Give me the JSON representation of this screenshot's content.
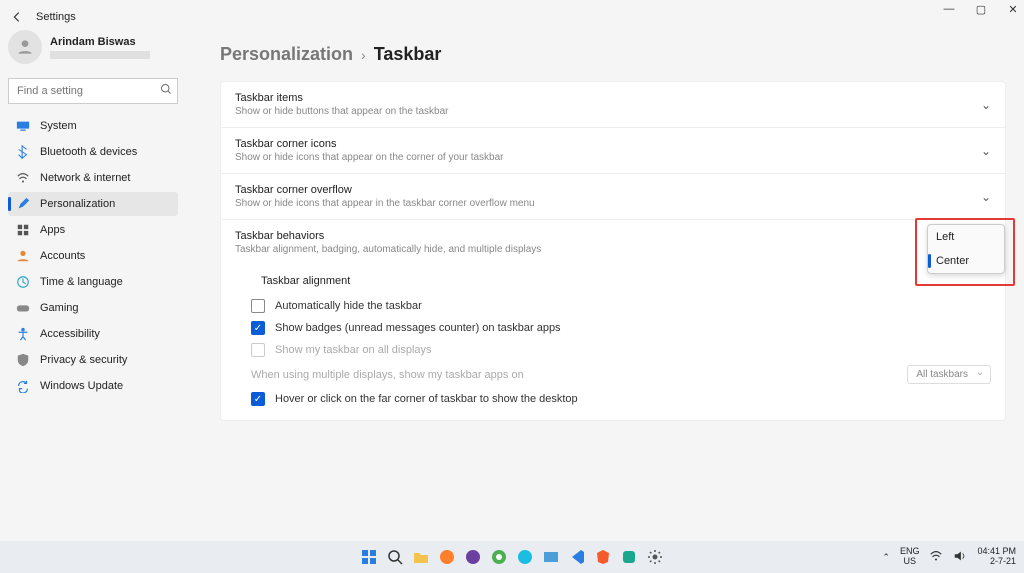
{
  "window": {
    "title": "Settings"
  },
  "user": {
    "name": "Arindam Biswas"
  },
  "search": {
    "placeholder": "Find a setting"
  },
  "nav": {
    "items": [
      {
        "label": "System"
      },
      {
        "label": "Bluetooth & devices"
      },
      {
        "label": "Network & internet"
      },
      {
        "label": "Personalization"
      },
      {
        "label": "Apps"
      },
      {
        "label": "Accounts"
      },
      {
        "label": "Time & language"
      },
      {
        "label": "Gaming"
      },
      {
        "label": "Accessibility"
      },
      {
        "label": "Privacy & security"
      },
      {
        "label": "Windows Update"
      }
    ]
  },
  "breadcrumb": {
    "parent": "Personalization",
    "sep": "›",
    "current": "Taskbar"
  },
  "sections": {
    "items": {
      "title": "Taskbar items",
      "desc": "Show or hide buttons that appear on the taskbar"
    },
    "corner": {
      "title": "Taskbar corner icons",
      "desc": "Show or hide icons that appear on the corner of your taskbar"
    },
    "overflow": {
      "title": "Taskbar corner overflow",
      "desc": "Show or hide icons that appear in the taskbar corner overflow menu"
    },
    "behaviors": {
      "title": "Taskbar behaviors",
      "desc": "Taskbar alignment, badging, automatically hide, and multiple displays"
    }
  },
  "behaviors": {
    "alignment_label": "Taskbar alignment",
    "alignment_options": {
      "left": "Left",
      "center": "Center"
    },
    "auto_hide": "Automatically hide the taskbar",
    "badges": "Show badges (unread messages counter) on taskbar apps",
    "all_displays": "Show my taskbar on all displays",
    "multi_desc": "When using multiple displays, show my taskbar apps on",
    "multi_value": "All taskbars",
    "hover": "Hover or click on the far corner of taskbar to show the desktop"
  },
  "systray": {
    "lang1": "ENG",
    "lang2": "US",
    "time": "04:41 PM",
    "date": "2-7-21"
  }
}
